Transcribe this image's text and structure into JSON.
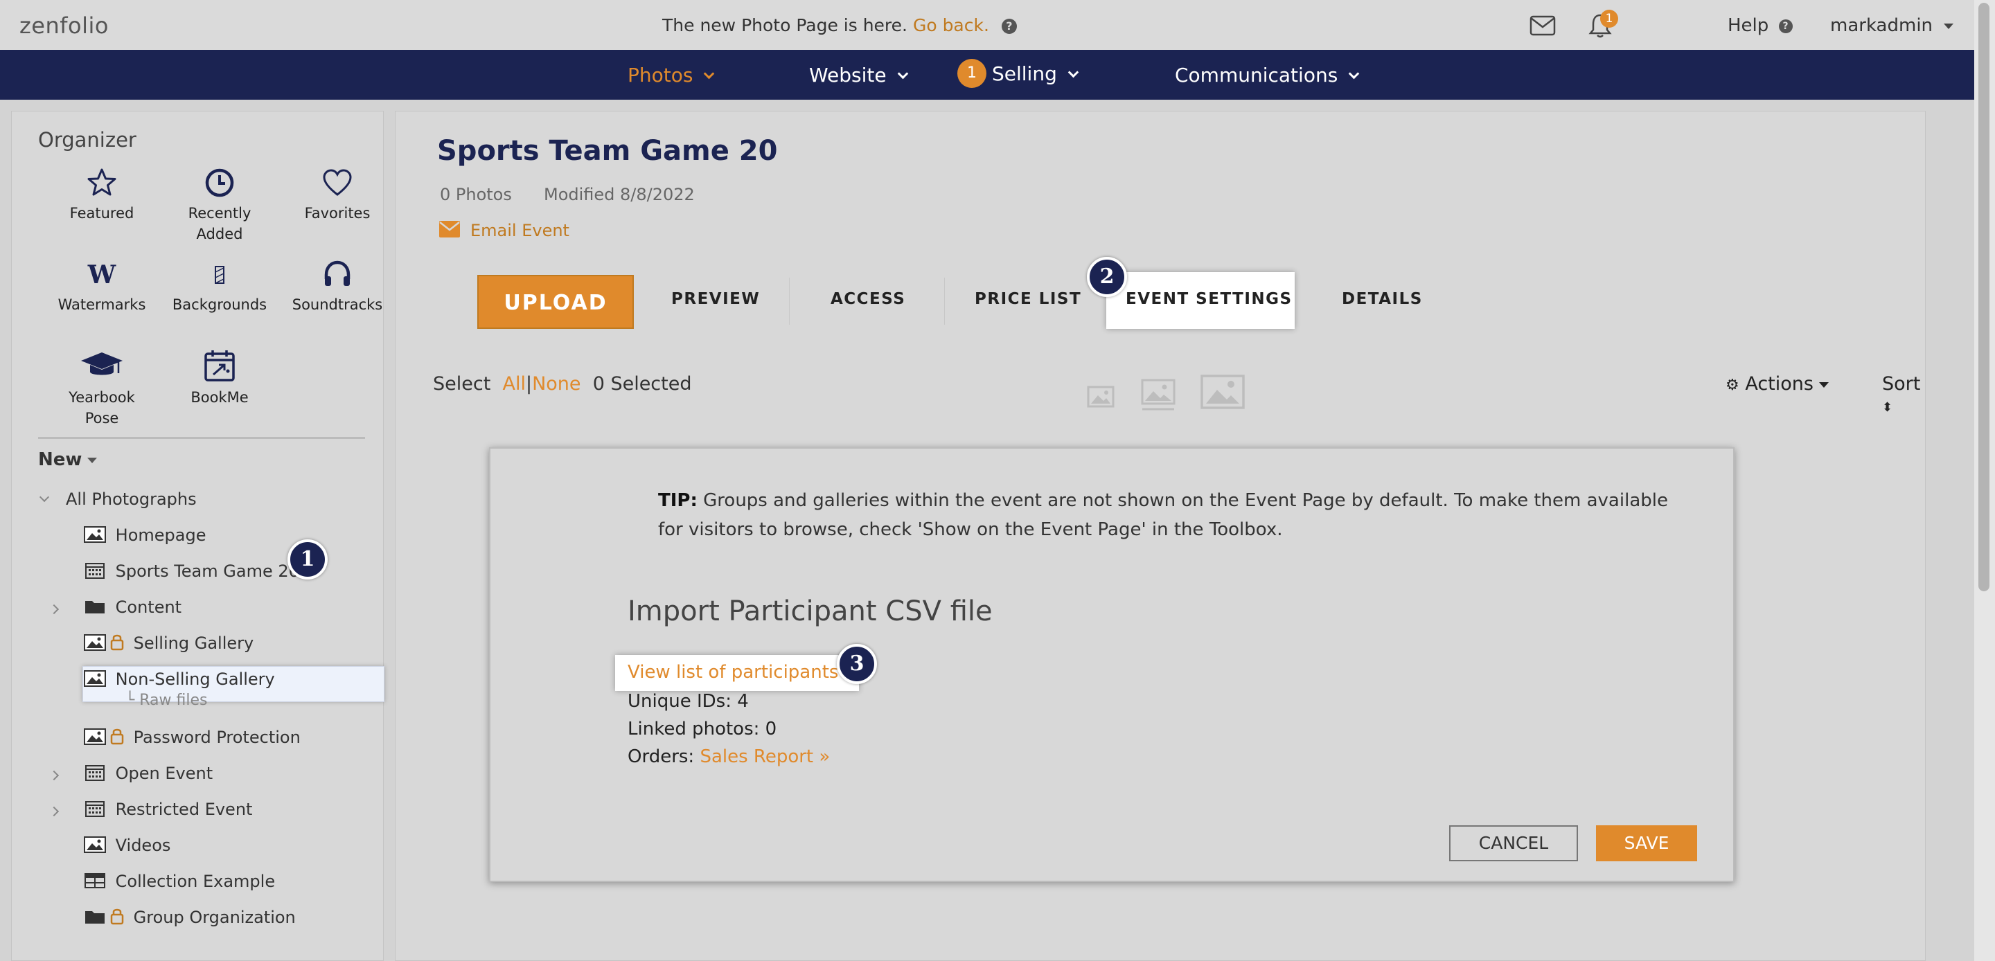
{
  "topbar": {
    "logo": "zenfolio",
    "notice": "The new Photo Page is here.",
    "go_back": "Go back.",
    "notification_count": "1",
    "help": "Help",
    "user": "markadmin"
  },
  "nav": {
    "photos": "Photos",
    "website": "Website",
    "selling": "Selling",
    "selling_badge": "1",
    "communications": "Communications"
  },
  "sidebar": {
    "title": "Organizer",
    "tools": [
      {
        "label": "Featured",
        "icon": "star-icon"
      },
      {
        "label": "Recently Added",
        "icon": "clock-icon"
      },
      {
        "label": "Favorites",
        "icon": "heart-icon"
      },
      {
        "label": "Watermarks",
        "icon": "watermark-icon"
      },
      {
        "label": "Backgrounds",
        "icon": "background-icon"
      },
      {
        "label": "Soundtracks",
        "icon": "headphones-icon"
      },
      {
        "label": "Yearbook Pose",
        "icon": "graduation-cap-icon"
      },
      {
        "label": "BookMe",
        "icon": "calendar-icon"
      }
    ],
    "new_label": "New",
    "tree": {
      "all_photographs": "All Photographs",
      "homepage": "Homepage",
      "sports_team": "Sports Team Game 20",
      "content": "Content",
      "selling_gallery": "Selling Gallery",
      "non_selling_gallery": "Non-Selling Gallery",
      "raw_files": "Raw files",
      "password_protection": "Password Protection",
      "open_event": "Open Event",
      "restricted_event": "Restricted Event",
      "videos": "Videos",
      "collection_example": "Collection Example",
      "group_organization": "Group Organization"
    }
  },
  "main": {
    "title": "Sports Team Game 20",
    "photo_count": "0 Photos",
    "modified": "Modified 8/8/2022",
    "email_event": "Email Event",
    "upload": "UPLOAD",
    "tabs": {
      "preview": "PREVIEW",
      "access": "ACCESS",
      "price_list": "PRICE LIST",
      "event_settings": "EVENT SETTINGS",
      "details": "DETAILS"
    },
    "select_label": "Select",
    "select_all": "All",
    "select_divider": "|",
    "select_none": "None",
    "selected_count": "0 Selected",
    "actions": "Actions",
    "sort": "Sort"
  },
  "callouts": {
    "one": "1",
    "two": "2",
    "three": "3"
  },
  "dialog": {
    "tip_label": "TIP:",
    "tip_text": "Groups and galleries within the event are not shown on the Event Page by default. To make them available for visitors to browse, check 'Show on the Event Page' in the Toolbox.",
    "import_title": "Import Participant CSV file",
    "participants_link": "View list of participants »",
    "unique_ids": "Unique IDs: 4",
    "linked_photos": "Linked photos: 0",
    "orders_label": "Orders:",
    "sales_report": "Sales Report »",
    "cancel": "CANCEL",
    "save": "SAVE"
  },
  "colors": {
    "navy": "#1b2352",
    "accent": "#e08a2c",
    "background": "#d8d8d8"
  }
}
